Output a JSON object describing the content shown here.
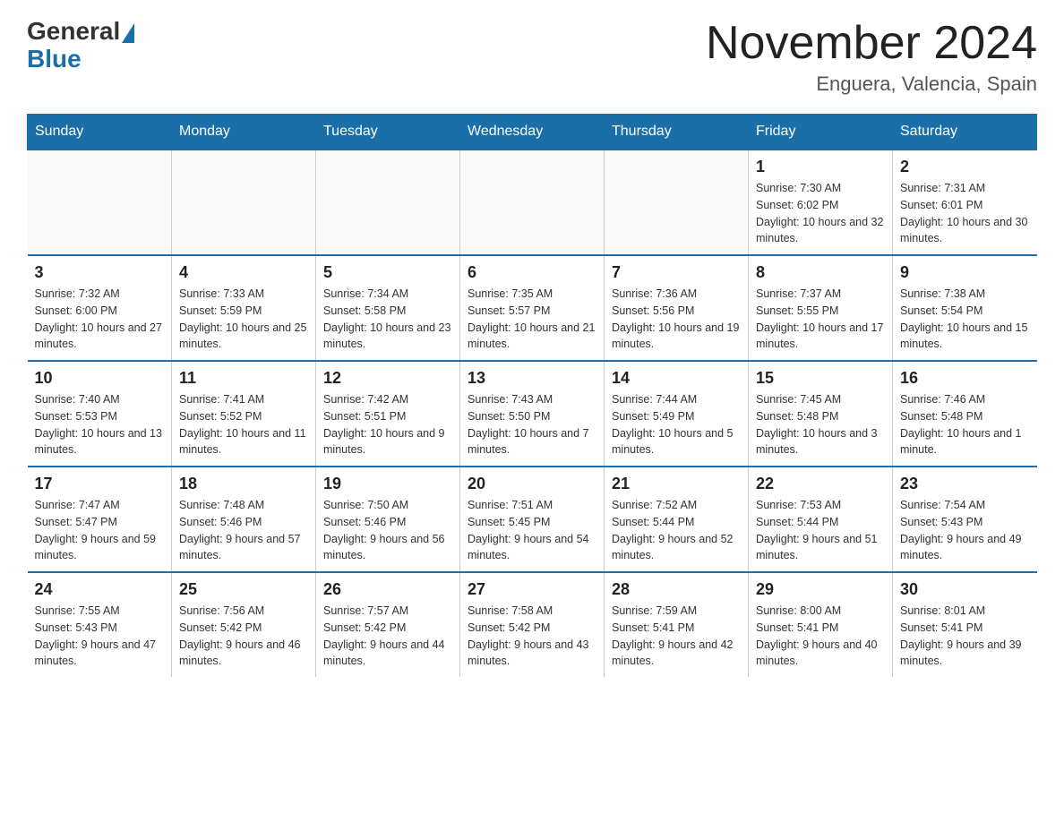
{
  "header": {
    "logo_general": "General",
    "logo_blue": "Blue",
    "title": "November 2024",
    "subtitle": "Enguera, Valencia, Spain"
  },
  "weekdays": [
    "Sunday",
    "Monday",
    "Tuesday",
    "Wednesday",
    "Thursday",
    "Friday",
    "Saturday"
  ],
  "weeks": [
    [
      {
        "day": "",
        "sunrise": "",
        "sunset": "",
        "daylight": ""
      },
      {
        "day": "",
        "sunrise": "",
        "sunset": "",
        "daylight": ""
      },
      {
        "day": "",
        "sunrise": "",
        "sunset": "",
        "daylight": ""
      },
      {
        "day": "",
        "sunrise": "",
        "sunset": "",
        "daylight": ""
      },
      {
        "day": "",
        "sunrise": "",
        "sunset": "",
        "daylight": ""
      },
      {
        "day": "1",
        "sunrise": "Sunrise: 7:30 AM",
        "sunset": "Sunset: 6:02 PM",
        "daylight": "Daylight: 10 hours and 32 minutes."
      },
      {
        "day": "2",
        "sunrise": "Sunrise: 7:31 AM",
        "sunset": "Sunset: 6:01 PM",
        "daylight": "Daylight: 10 hours and 30 minutes."
      }
    ],
    [
      {
        "day": "3",
        "sunrise": "Sunrise: 7:32 AM",
        "sunset": "Sunset: 6:00 PM",
        "daylight": "Daylight: 10 hours and 27 minutes."
      },
      {
        "day": "4",
        "sunrise": "Sunrise: 7:33 AM",
        "sunset": "Sunset: 5:59 PM",
        "daylight": "Daylight: 10 hours and 25 minutes."
      },
      {
        "day": "5",
        "sunrise": "Sunrise: 7:34 AM",
        "sunset": "Sunset: 5:58 PM",
        "daylight": "Daylight: 10 hours and 23 minutes."
      },
      {
        "day": "6",
        "sunrise": "Sunrise: 7:35 AM",
        "sunset": "Sunset: 5:57 PM",
        "daylight": "Daylight: 10 hours and 21 minutes."
      },
      {
        "day": "7",
        "sunrise": "Sunrise: 7:36 AM",
        "sunset": "Sunset: 5:56 PM",
        "daylight": "Daylight: 10 hours and 19 minutes."
      },
      {
        "day": "8",
        "sunrise": "Sunrise: 7:37 AM",
        "sunset": "Sunset: 5:55 PM",
        "daylight": "Daylight: 10 hours and 17 minutes."
      },
      {
        "day": "9",
        "sunrise": "Sunrise: 7:38 AM",
        "sunset": "Sunset: 5:54 PM",
        "daylight": "Daylight: 10 hours and 15 minutes."
      }
    ],
    [
      {
        "day": "10",
        "sunrise": "Sunrise: 7:40 AM",
        "sunset": "Sunset: 5:53 PM",
        "daylight": "Daylight: 10 hours and 13 minutes."
      },
      {
        "day": "11",
        "sunrise": "Sunrise: 7:41 AM",
        "sunset": "Sunset: 5:52 PM",
        "daylight": "Daylight: 10 hours and 11 minutes."
      },
      {
        "day": "12",
        "sunrise": "Sunrise: 7:42 AM",
        "sunset": "Sunset: 5:51 PM",
        "daylight": "Daylight: 10 hours and 9 minutes."
      },
      {
        "day": "13",
        "sunrise": "Sunrise: 7:43 AM",
        "sunset": "Sunset: 5:50 PM",
        "daylight": "Daylight: 10 hours and 7 minutes."
      },
      {
        "day": "14",
        "sunrise": "Sunrise: 7:44 AM",
        "sunset": "Sunset: 5:49 PM",
        "daylight": "Daylight: 10 hours and 5 minutes."
      },
      {
        "day": "15",
        "sunrise": "Sunrise: 7:45 AM",
        "sunset": "Sunset: 5:48 PM",
        "daylight": "Daylight: 10 hours and 3 minutes."
      },
      {
        "day": "16",
        "sunrise": "Sunrise: 7:46 AM",
        "sunset": "Sunset: 5:48 PM",
        "daylight": "Daylight: 10 hours and 1 minute."
      }
    ],
    [
      {
        "day": "17",
        "sunrise": "Sunrise: 7:47 AM",
        "sunset": "Sunset: 5:47 PM",
        "daylight": "Daylight: 9 hours and 59 minutes."
      },
      {
        "day": "18",
        "sunrise": "Sunrise: 7:48 AM",
        "sunset": "Sunset: 5:46 PM",
        "daylight": "Daylight: 9 hours and 57 minutes."
      },
      {
        "day": "19",
        "sunrise": "Sunrise: 7:50 AM",
        "sunset": "Sunset: 5:46 PM",
        "daylight": "Daylight: 9 hours and 56 minutes."
      },
      {
        "day": "20",
        "sunrise": "Sunrise: 7:51 AM",
        "sunset": "Sunset: 5:45 PM",
        "daylight": "Daylight: 9 hours and 54 minutes."
      },
      {
        "day": "21",
        "sunrise": "Sunrise: 7:52 AM",
        "sunset": "Sunset: 5:44 PM",
        "daylight": "Daylight: 9 hours and 52 minutes."
      },
      {
        "day": "22",
        "sunrise": "Sunrise: 7:53 AM",
        "sunset": "Sunset: 5:44 PM",
        "daylight": "Daylight: 9 hours and 51 minutes."
      },
      {
        "day": "23",
        "sunrise": "Sunrise: 7:54 AM",
        "sunset": "Sunset: 5:43 PM",
        "daylight": "Daylight: 9 hours and 49 minutes."
      }
    ],
    [
      {
        "day": "24",
        "sunrise": "Sunrise: 7:55 AM",
        "sunset": "Sunset: 5:43 PM",
        "daylight": "Daylight: 9 hours and 47 minutes."
      },
      {
        "day": "25",
        "sunrise": "Sunrise: 7:56 AM",
        "sunset": "Sunset: 5:42 PM",
        "daylight": "Daylight: 9 hours and 46 minutes."
      },
      {
        "day": "26",
        "sunrise": "Sunrise: 7:57 AM",
        "sunset": "Sunset: 5:42 PM",
        "daylight": "Daylight: 9 hours and 44 minutes."
      },
      {
        "day": "27",
        "sunrise": "Sunrise: 7:58 AM",
        "sunset": "Sunset: 5:42 PM",
        "daylight": "Daylight: 9 hours and 43 minutes."
      },
      {
        "day": "28",
        "sunrise": "Sunrise: 7:59 AM",
        "sunset": "Sunset: 5:41 PM",
        "daylight": "Daylight: 9 hours and 42 minutes."
      },
      {
        "day": "29",
        "sunrise": "Sunrise: 8:00 AM",
        "sunset": "Sunset: 5:41 PM",
        "daylight": "Daylight: 9 hours and 40 minutes."
      },
      {
        "day": "30",
        "sunrise": "Sunrise: 8:01 AM",
        "sunset": "Sunset: 5:41 PM",
        "daylight": "Daylight: 9 hours and 39 minutes."
      }
    ]
  ]
}
